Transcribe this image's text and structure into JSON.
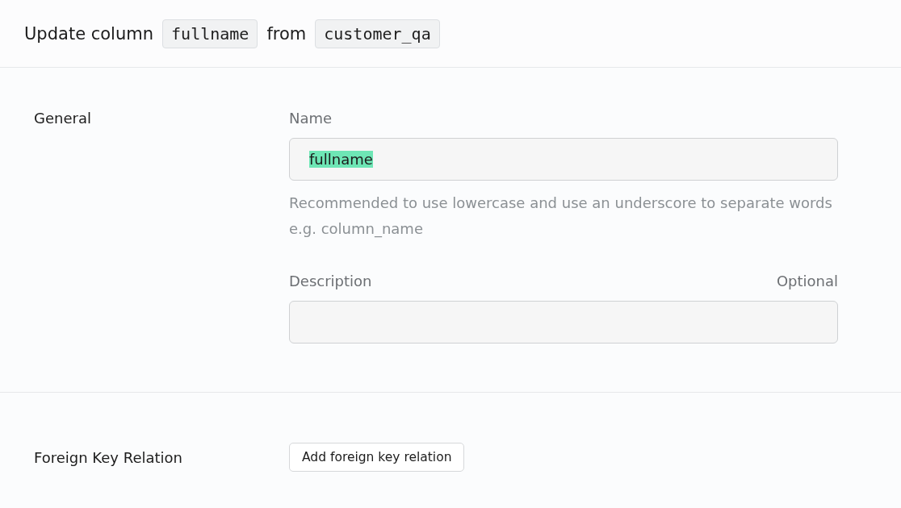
{
  "header": {
    "parts": [
      {
        "kind": "text",
        "text": "Update column"
      },
      {
        "kind": "code",
        "text": "fullname"
      },
      {
        "kind": "text",
        "text": "from"
      },
      {
        "kind": "code",
        "text": "customer_qa"
      }
    ]
  },
  "sections": [
    {
      "title": "General",
      "kind": "fields",
      "fields": [
        {
          "label": "Name",
          "value": "fullname",
          "selected": true,
          "help": "Recommended to use lowercase and use an underscore to separate words e.g. column_name"
        },
        {
          "label": "Description",
          "optional": "Optional"
        }
      ]
    },
    {
      "title": "Foreign Key Relation",
      "kind": "action",
      "button": "Add foreign key relation"
    }
  ]
}
